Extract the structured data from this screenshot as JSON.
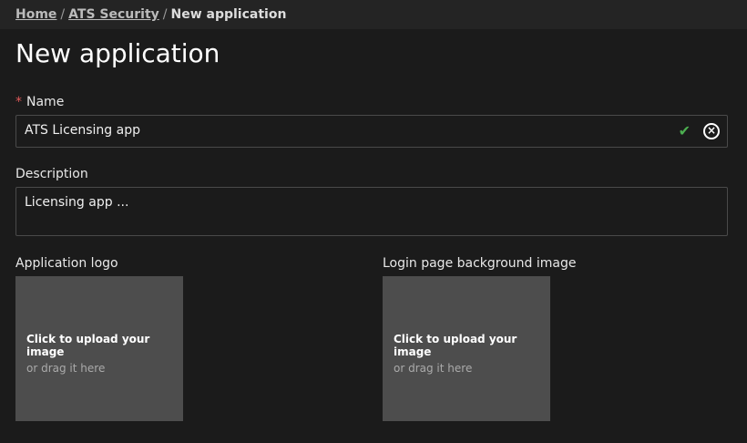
{
  "breadcrumb": {
    "items": [
      "Home",
      "ATS Security"
    ],
    "current": "New application",
    "separator": "/"
  },
  "page_title": "New application",
  "form": {
    "name": {
      "label": "Name",
      "required_mark": "*",
      "value": "ATS Licensing app"
    },
    "description": {
      "label": "Description",
      "value": "Licensing app ..."
    },
    "logo": {
      "label": "Application logo",
      "upload_text": "Click to upload your image",
      "drag_text": "or drag it here"
    },
    "background": {
      "label": "Login page background image",
      "upload_text": "Click to upload your image",
      "drag_text": "or drag it here"
    }
  },
  "colors": {
    "valid": "#4caf50",
    "required": "#e05a5a",
    "upload_bg": "#4d4d4d"
  }
}
